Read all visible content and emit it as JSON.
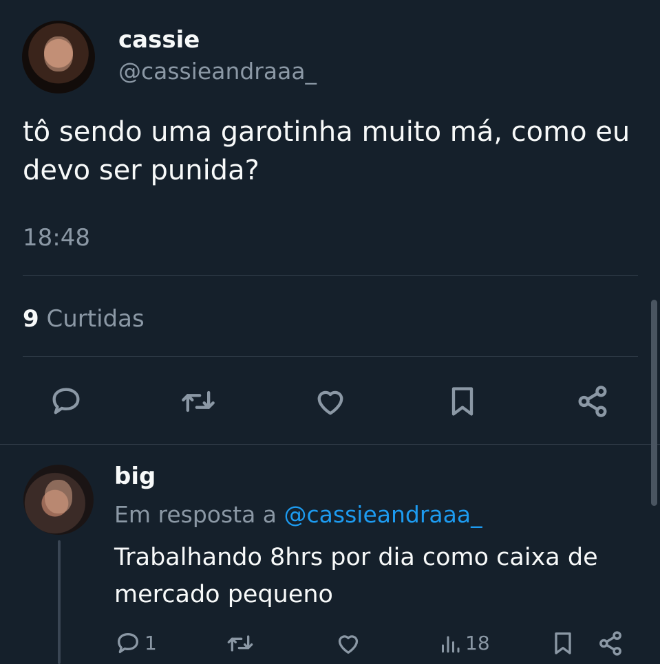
{
  "tweet": {
    "author_name": "cassie",
    "author_handle": "@cassieandraaa_",
    "text": "tô sendo uma garotinha muito má, como eu devo ser punida?",
    "time": "18:48",
    "likes_count": "9",
    "likes_label": "Curtidas",
    "actions": [
      "reply-icon",
      "retweet-icon",
      "like-icon",
      "bookmark-icon",
      "share-icon"
    ]
  },
  "reply": {
    "author_name": "big",
    "context_prefix": "Em resposta a ",
    "context_handle": "@cassieandraaa_",
    "text": "Trabalhando 8hrs por dia como caixa de mercado pequeno",
    "reply_count": "1",
    "views_count": "18",
    "actions": [
      "reply-icon",
      "retweet-icon",
      "like-icon",
      "views-icon",
      "bookmark-icon",
      "share-icon"
    ]
  },
  "colors": {
    "background": "#15202b",
    "text": "#f7f9f9",
    "muted": "#8b98a5",
    "accent": "#1d9bf0",
    "divider": "#2f3b47"
  }
}
